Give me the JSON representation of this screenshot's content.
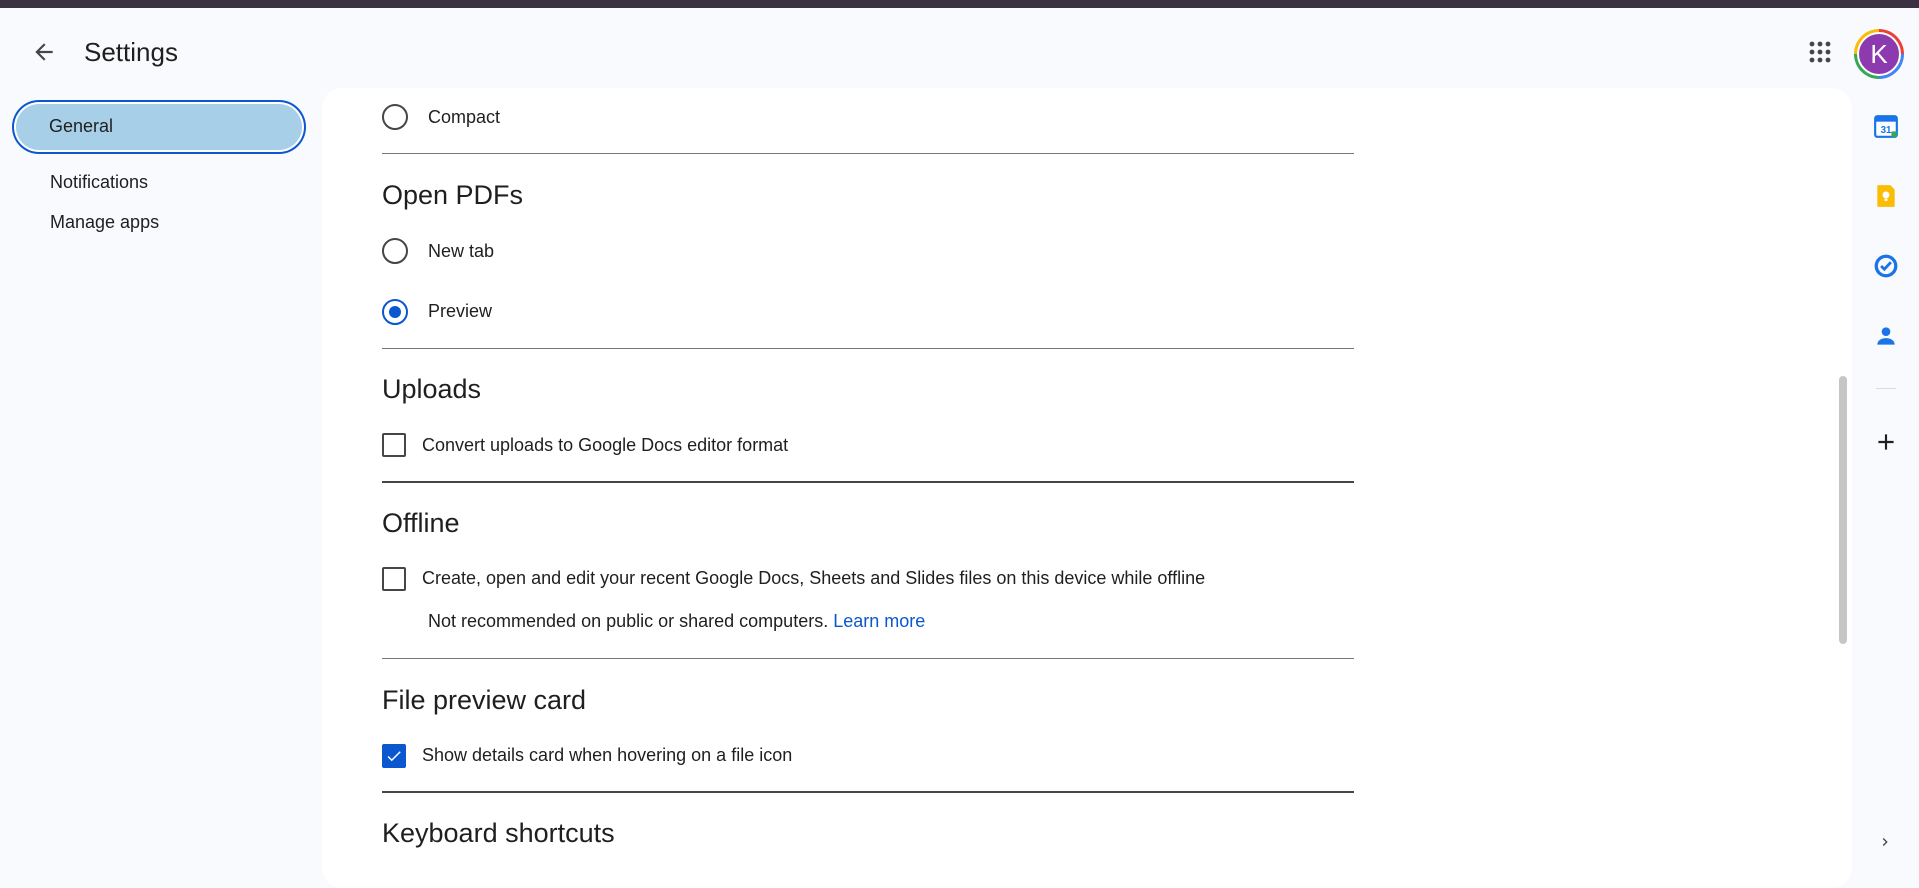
{
  "header": {
    "title": "Settings",
    "back_icon": "arrow-back-icon",
    "apps_icon": "apps-grid-icon",
    "avatar_letter": "K"
  },
  "nav": {
    "items": [
      {
        "label": "General",
        "active": true
      },
      {
        "label": "Notifications",
        "active": false
      },
      {
        "label": "Manage apps",
        "active": false
      }
    ]
  },
  "sections": {
    "density": {
      "options": [
        {
          "label": "Compact",
          "checked": false
        }
      ]
    },
    "open_pdfs": {
      "title": "Open PDFs",
      "options": [
        {
          "label": "New tab",
          "checked": false
        },
        {
          "label": "Preview",
          "checked": true
        }
      ]
    },
    "uploads": {
      "title": "Uploads",
      "checkbox_label": "Convert uploads to Google Docs editor format",
      "checked": false
    },
    "offline": {
      "title": "Offline",
      "checkbox_label": "Create, open and edit your recent Google Docs, Sheets and Slides files on this device while offline",
      "checked": false,
      "note": "Not recommended on public or shared computers.",
      "link": "Learn more"
    },
    "file_preview_card": {
      "title": "File preview card",
      "checkbox_label": "Show details card when hovering on a file icon",
      "checked": true
    },
    "keyboard_shortcuts": {
      "title": "Keyboard shortcuts"
    }
  },
  "side_panel": {
    "calendar_day": "31",
    "icons": [
      "calendar-icon",
      "keep-icon",
      "tasks-icon",
      "contacts-icon",
      "add-icon"
    ]
  },
  "colors": {
    "accent": "#0b57d0",
    "nav_active_bg": "#a8cfe8",
    "avatar_bg": "#8e3aaf",
    "page_bg": "#f8fafd"
  }
}
